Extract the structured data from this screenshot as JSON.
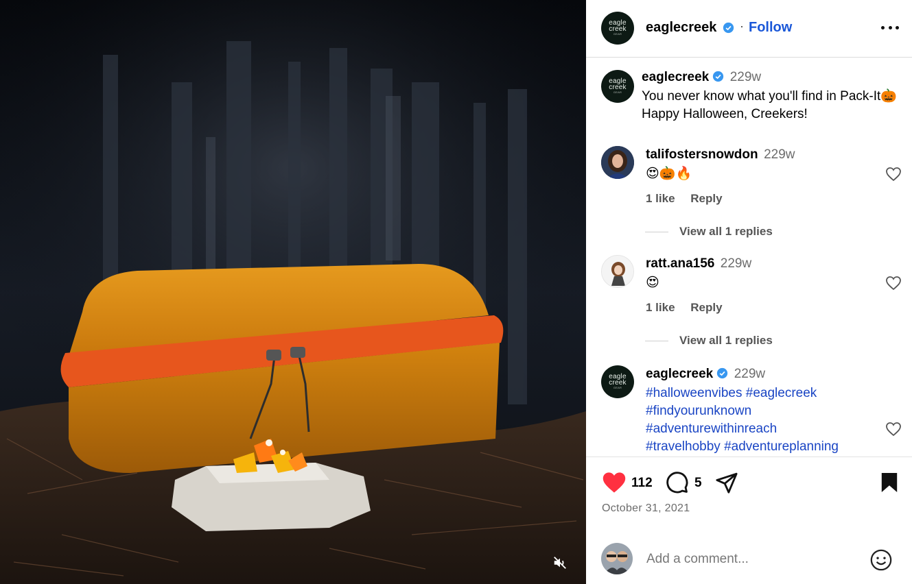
{
  "post": {
    "username": "eaglecreek",
    "follow_label": "Follow",
    "dot": "·",
    "avatar_lines": [
      "eagle",
      "creek",
      "GEAR"
    ]
  },
  "caption": {
    "username": "eaglecreek",
    "time": "229w",
    "text": "You never know what you'll find in Pack-It🎃 Happy Halloween, Creekers!"
  },
  "comments": [
    {
      "username": "talifostersnowdon",
      "time": "229w",
      "text": "😍🎃🔥",
      "likes": "1 like",
      "reply_label": "Reply",
      "view_replies": "View all 1 replies"
    },
    {
      "username": "ratt.ana156",
      "time": "229w",
      "text": "😍",
      "likes": "1 like",
      "reply_label": "Reply",
      "view_replies": "View all 1 replies"
    },
    {
      "username": "eaglecreek",
      "time": "229w",
      "hashtags": [
        "#halloweenvibes",
        "#eaglecreek",
        "#findyourunknown",
        "#adventurewithinreach",
        "#travelhobby",
        "#adventureplanning"
      ]
    }
  ],
  "actions": {
    "like_count": "112",
    "comment_count": "5",
    "liked": true,
    "saved": true,
    "like_color": "#ff3040"
  },
  "date": "October 31, 2021",
  "add_comment": {
    "placeholder": "Add a comment..."
  },
  "colors": {
    "link_blue": "#1a57d8",
    "hashtag_blue": "#1a45c4",
    "verified_blue": "#3897f0"
  },
  "icons": {
    "mute": "speaker-muted-icon",
    "more": "more-horizontal-icon",
    "verified": "verified-badge-icon",
    "heart": "heart-icon",
    "comment": "comment-bubble-icon",
    "share": "paper-plane-icon",
    "save": "bookmark-icon",
    "emoji": "emoji-smile-icon"
  }
}
